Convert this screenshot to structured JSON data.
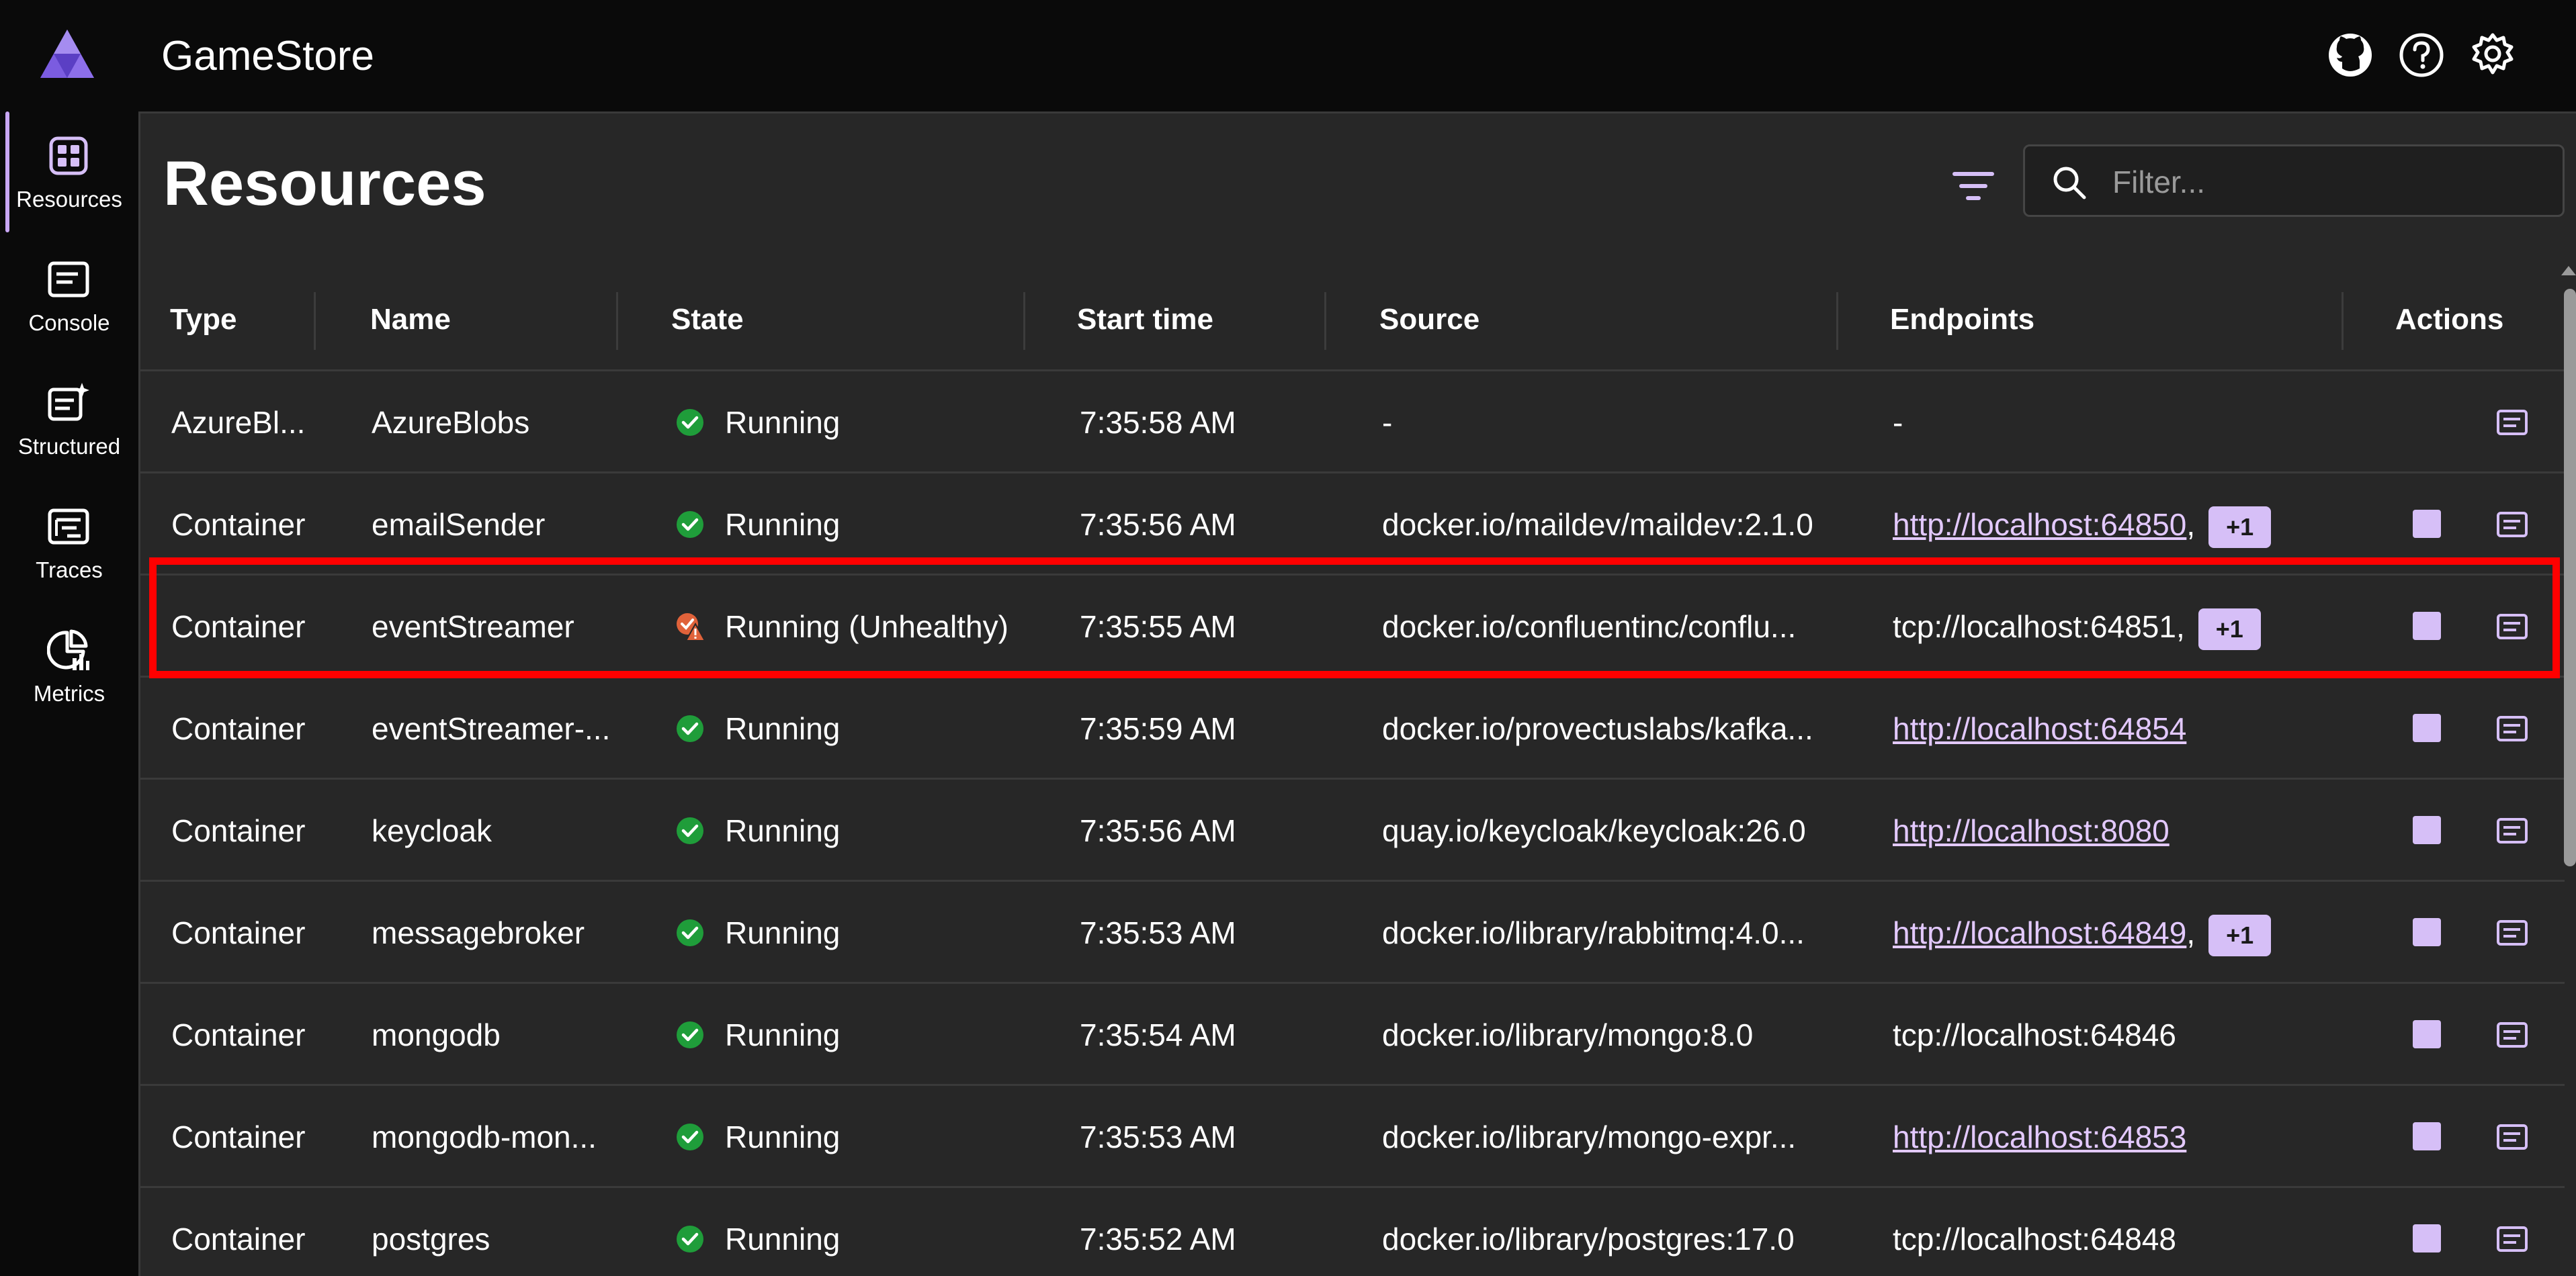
{
  "header": {
    "app_title": "GameStore",
    "icons": [
      "github-icon",
      "help-icon",
      "settings-icon"
    ]
  },
  "sidebar": {
    "items": [
      {
        "label": "Resources",
        "icon": "resources-icon",
        "active": true
      },
      {
        "label": "Console",
        "icon": "console-icon"
      },
      {
        "label": "Structured",
        "icon": "structured-icon"
      },
      {
        "label": "Traces",
        "icon": "traces-icon"
      },
      {
        "label": "Metrics",
        "icon": "metrics-icon"
      }
    ]
  },
  "main": {
    "title": "Resources",
    "search": {
      "placeholder": "Filter..."
    }
  },
  "table": {
    "headers": {
      "type": "Type",
      "name": "Name",
      "state": "State",
      "start_time": "Start time",
      "source": "Source",
      "endpoints": "Endpoints",
      "actions": "Actions"
    },
    "rows": [
      {
        "type": "AzureBl...",
        "name": "AzureBlobs",
        "state": "Running",
        "health": "ok",
        "start_time": "7:35:58 AM",
        "source": "-",
        "endpoint": "-",
        "endpoint_link": false,
        "extra": "",
        "has_stop": false
      },
      {
        "type": "Container",
        "name": "emailSender",
        "state": "Running",
        "health": "ok",
        "start_time": "7:35:56 AM",
        "source": "docker.io/maildev/maildev:2.1.0",
        "endpoint": "http://localhost:64850",
        "endpoint_link": true,
        "extra": "+1",
        "has_stop": true
      },
      {
        "type": "Container",
        "name": "eventStreamer",
        "state": "Running (Unhealthy)",
        "health": "warning",
        "start_time": "7:35:55 AM",
        "source": "docker.io/confluentinc/conflu...",
        "endpoint": "tcp://localhost:64851",
        "endpoint_link": false,
        "extra": "+1",
        "has_stop": true
      },
      {
        "type": "Container",
        "name": "eventStreamer-...",
        "state": "Running",
        "health": "ok",
        "start_time": "7:35:59 AM",
        "source": "docker.io/provectuslabs/kafka...",
        "endpoint": "http://localhost:64854",
        "endpoint_link": true,
        "extra": "",
        "has_stop": true
      },
      {
        "type": "Container",
        "name": "keycloak",
        "state": "Running",
        "health": "ok",
        "start_time": "7:35:56 AM",
        "source": "quay.io/keycloak/keycloak:26.0",
        "endpoint": "http://localhost:8080",
        "endpoint_link": true,
        "extra": "",
        "has_stop": true
      },
      {
        "type": "Container",
        "name": "messagebroker",
        "state": "Running",
        "health": "ok",
        "start_time": "7:35:53 AM",
        "source": "docker.io/library/rabbitmq:4.0...",
        "endpoint": "http://localhost:64849",
        "endpoint_link": true,
        "extra": "+1",
        "has_stop": true
      },
      {
        "type": "Container",
        "name": "mongodb",
        "state": "Running",
        "health": "ok",
        "start_time": "7:35:54 AM",
        "source": "docker.io/library/mongo:8.0",
        "endpoint": "tcp://localhost:64846",
        "endpoint_link": false,
        "extra": "",
        "has_stop": true
      },
      {
        "type": "Container",
        "name": "mongodb-mon...",
        "state": "Running",
        "health": "ok",
        "start_time": "7:35:53 AM",
        "source": "docker.io/library/mongo-expr...",
        "endpoint": "http://localhost:64853",
        "endpoint_link": true,
        "extra": "",
        "has_stop": true
      },
      {
        "type": "Container",
        "name": "postgres",
        "state": "Running",
        "health": "ok",
        "start_time": "7:35:52 AM",
        "source": "docker.io/library/postgres:17.0",
        "endpoint": "tcp://localhost:64848",
        "endpoint_link": false,
        "extra": "",
        "has_stop": true
      }
    ]
  },
  "colors": {
    "accent": "#d6bff7",
    "link": "#e3c9ff",
    "running_ok": "#1f9d3a",
    "unhealthy": "#e0623a",
    "highlight": "#ff0000",
    "panel_bg": "#272727",
    "chrome_bg": "#0a0a0a"
  }
}
